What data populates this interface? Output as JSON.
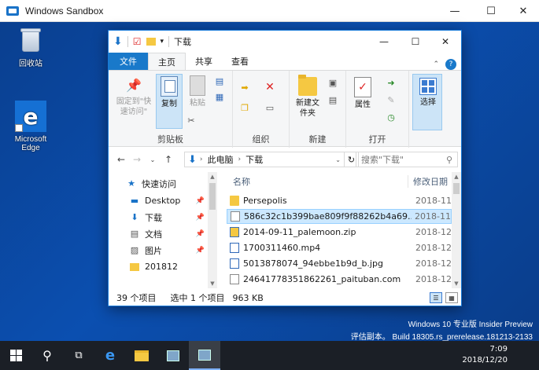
{
  "sandbox": {
    "title": "Windows Sandbox",
    "minimize": "—",
    "maximize": "☐",
    "close": "✕"
  },
  "desktop": {
    "recycle_bin": "回收站",
    "edge": "Microsoft Edge",
    "watermark_line1": "Windows 10 专业版 Insider Preview",
    "watermark_line2": "评估副本。 Build 18305.rs_prerelease.181213-2133"
  },
  "explorer": {
    "title": "下载",
    "tabs": [
      "文件",
      "主页",
      "共享",
      "查看"
    ],
    "ribbon": {
      "pin_quick_access": "固定到\"快速访问\"",
      "copy": "复制",
      "paste": "粘贴",
      "clipboard": "剪贴板",
      "organize": "组织",
      "new_folder": "新建文件夹",
      "new": "新建",
      "properties": "属性",
      "open": "打开",
      "select": "选择"
    },
    "address": {
      "this_pc": "此电脑",
      "downloads": "下载",
      "search_placeholder": "搜索\"下载\""
    },
    "nav": [
      {
        "label": "快速访问",
        "pinned": false
      },
      {
        "label": "Desktop",
        "pinned": true
      },
      {
        "label": "下载",
        "pinned": true
      },
      {
        "label": "文档",
        "pinned": true
      },
      {
        "label": "图片",
        "pinned": true
      },
      {
        "label": "201812",
        "pinned": false
      }
    ],
    "columns": {
      "name": "名称",
      "date": "修改日期"
    },
    "files": [
      {
        "name": "Persepolis",
        "date": "2018-11",
        "type": "folder"
      },
      {
        "name": "586c32c1b399bae809f9f88262b4a69...",
        "date": "2018-11",
        "type": "file"
      },
      {
        "name": "2014-09-11_palemoon.zip",
        "date": "2018-12",
        "type": "zip"
      },
      {
        "name": "1700311460.mp4",
        "date": "2018-12",
        "type": "video"
      },
      {
        "name": "5013878074_94ebbe1b9d_b.jpg",
        "date": "2018-12",
        "type": "image"
      },
      {
        "name": "24641778351862261_paituban.com",
        "date": "2018-12",
        "type": "file"
      }
    ],
    "status": {
      "count": "39 个项目",
      "selected": "选中 1 个项目",
      "size": "963 KB"
    }
  },
  "taskbar": {
    "time": "7:09",
    "date": "2018/12/20"
  },
  "colors": {
    "accent": "#1979ca",
    "desktop": "#0b4fb0",
    "taskbar": "#1b1f26"
  }
}
